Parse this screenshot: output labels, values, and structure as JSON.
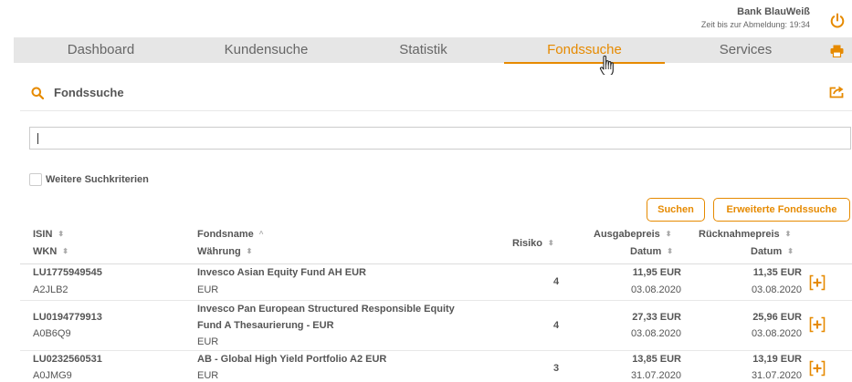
{
  "header": {
    "bank_name": "Bank BlauWeiß",
    "logout_time": "Zeit bis zur Abmeldung: 19:34"
  },
  "nav": {
    "tabs": [
      {
        "label": "Dashboard"
      },
      {
        "label": "Kundensuche"
      },
      {
        "label": "Statistik"
      },
      {
        "label": "Fondssuche"
      },
      {
        "label": "Services"
      }
    ],
    "active_tab": "Fondssuche"
  },
  "panel": {
    "title": "Fondssuche",
    "search_value": "",
    "more_criteria_label": "Weitere Suchkriterien",
    "more_criteria_checked": false,
    "search_button": "Suchen",
    "advanced_search_button": "Erweiterte Fondssuche"
  },
  "table": {
    "headers": {
      "isin": "ISIN",
      "wkn": "WKN",
      "fund_name": "Fondsname",
      "currency": "Währung",
      "risk": "Risiko",
      "issue_price": "Ausgabepreis",
      "issue_date": "Datum",
      "redemption_price": "Rücknahmepreis",
      "redemption_date": "Datum"
    },
    "rows": [
      {
        "isin": "LU1775949545",
        "wkn": "A2JLB2",
        "name_line1": "Invesco Asian Equity Fund AH EUR",
        "name_line2": "",
        "currency": "EUR",
        "risk": "4",
        "issue_price": "11,95 EUR",
        "issue_date": "03.08.2020",
        "redemption_price": "11,35 EUR",
        "redemption_date": "03.08.2020"
      },
      {
        "isin": "LU0194779913",
        "wkn": "A0B6Q9",
        "name_line1": "Invesco Pan European Structured Responsible Equity",
        "name_line2": "Fund A Thesaurierung - EUR",
        "currency": "EUR",
        "risk": "4",
        "issue_price": "27,33 EUR",
        "issue_date": "03.08.2020",
        "redemption_price": "25,96 EUR",
        "redemption_date": "03.08.2020"
      },
      {
        "isin": "LU0232560531",
        "wkn": "A0JMG9",
        "name_line1": "AB - Global High Yield Portfolio A2 EUR",
        "name_line2": "",
        "currency": "EUR",
        "risk": "3",
        "issue_price": "13,85 EUR",
        "issue_date": "31.07.2020",
        "redemption_price": "13,19 EUR",
        "redemption_date": "31.07.2020"
      }
    ]
  },
  "colors": {
    "accent": "#e68a00",
    "nav_bg": "#e6e6e6",
    "text": "#555555"
  },
  "icons": {
    "power": "power-icon",
    "printer": "printer-icon",
    "search": "search-icon",
    "export": "export-icon",
    "add": "add-icon",
    "sort": "sort-icon",
    "cursor": "hand-cursor-icon"
  }
}
